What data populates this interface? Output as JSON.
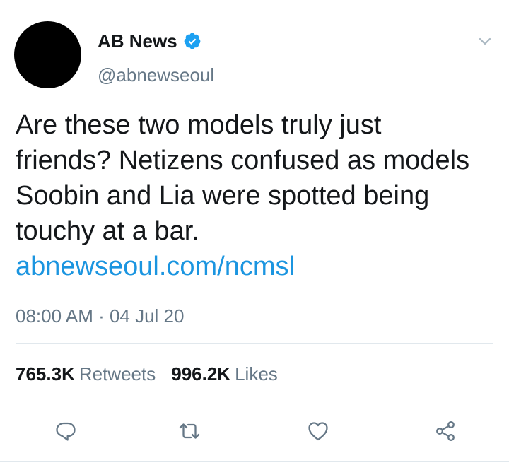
{
  "author": {
    "display_name": "AB News",
    "handle": "@abnewseoul",
    "verified": true
  },
  "tweet": {
    "text": "Are these two models truly just friends? Netizens confused as models Soobin and Lia were spotted being touchy at a bar.",
    "link": "abnewseoul.com/ncmsl",
    "timestamp": "08:00 AM · 04 Jul 20"
  },
  "stats": {
    "retweets_count": "765.3K",
    "retweets_label": "Retweets",
    "likes_count": "996.2K",
    "likes_label": "Likes"
  },
  "icons": {
    "verified": "verified-badge-icon",
    "menu": "chevron-down-icon",
    "reply": "reply-icon",
    "retweet": "retweet-icon",
    "like": "heart-icon",
    "share": "share-icon"
  },
  "colors": {
    "accent": "#1da1f2",
    "link": "#1b95e0",
    "muted": "#657786",
    "text": "#14171a",
    "divider": "#e1e8ed"
  }
}
